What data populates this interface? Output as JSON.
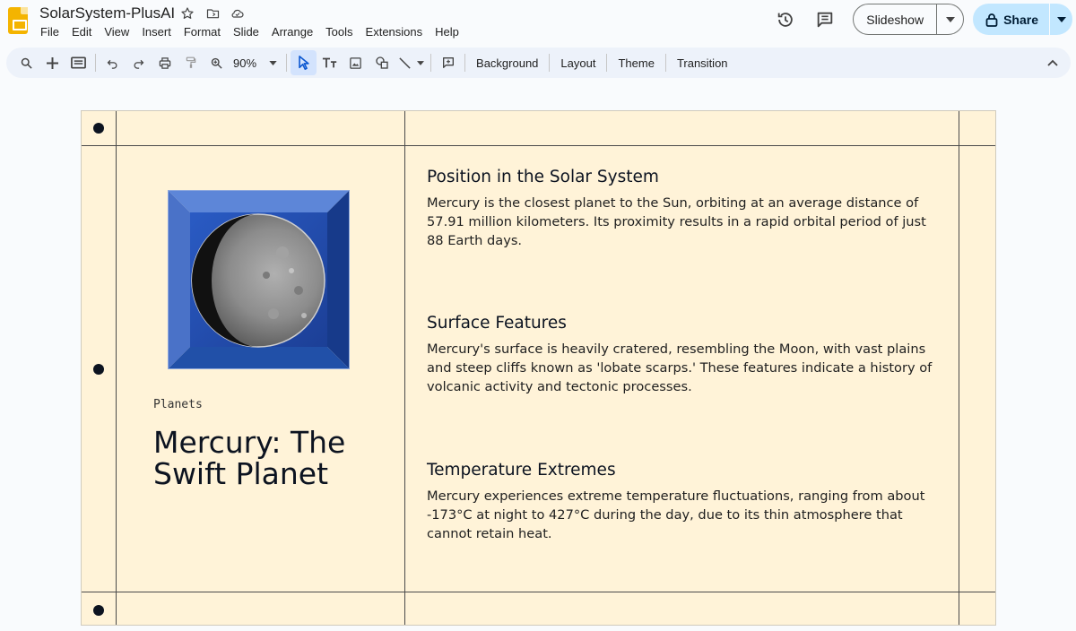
{
  "app": {
    "doc_title": "SolarSystem-PlusAI",
    "menu": [
      "File",
      "Edit",
      "View",
      "Insert",
      "Format",
      "Slide",
      "Arrange",
      "Tools",
      "Extensions",
      "Help"
    ],
    "slideshow_label": "Slideshow",
    "share_label": "Share"
  },
  "toolbar": {
    "zoom": "90%",
    "background_label": "Background",
    "layout_label": "Layout",
    "theme_label": "Theme",
    "transition_label": "Transition"
  },
  "slide": {
    "kicker": "Planets",
    "title": "Mercury: The Swift Planet",
    "sections": [
      {
        "heading": "Position in the Solar System",
        "body": "Mercury is the closest planet to the Sun, orbiting at an average distance of 57.91 million kilometers. Its proximity results in a rapid orbital period of just 88 Earth days."
      },
      {
        "heading": "Surface Features",
        "body": "Mercury's surface is heavily cratered, resembling the Moon, with vast plains and steep cliffs known as 'lobate scarps.' These features indicate a history of volcanic activity and tectonic processes."
      },
      {
        "heading": "Temperature Extremes",
        "body": "Mercury experiences extreme temperature fluctuations, ranging from about -173°C at night to 427°C during the day, due to its thin atmosphere that cannot retain heat."
      }
    ],
    "colors": {
      "background": "#fff3d8",
      "text": "#0c1320",
      "frame": "#1e4ea8"
    }
  }
}
